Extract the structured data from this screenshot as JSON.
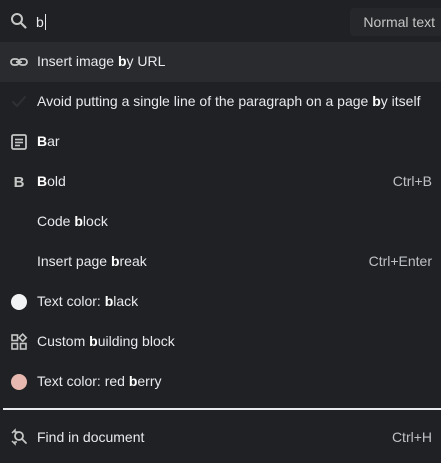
{
  "search": {
    "query": "b",
    "style_label": "Normal text"
  },
  "items": [
    {
      "icon": "link-icon",
      "pre": "Insert image ",
      "match": "b",
      "post": "y URL",
      "shortcut": ""
    },
    {
      "icon": "check-icon",
      "pre": "Avoid putting a single line of the paragraph on a page ",
      "match": "b",
      "post": "y itself",
      "shortcut": ""
    },
    {
      "icon": "paragraph-icon",
      "pre": "",
      "match": "B",
      "post": "ar",
      "shortcut": ""
    },
    {
      "icon": "bold-icon",
      "pre": "",
      "match": "B",
      "post": "old",
      "shortcut": "Ctrl+B"
    },
    {
      "icon": "",
      "pre": "Code ",
      "match": "b",
      "post": "lock",
      "shortcut": ""
    },
    {
      "icon": "",
      "pre": "Insert page ",
      "match": "b",
      "post": "reak",
      "shortcut": "Ctrl+Enter"
    },
    {
      "icon": "color-swatch-icon",
      "pre": "Text color: ",
      "match": "b",
      "post": "lack",
      "shortcut": ""
    },
    {
      "icon": "building-block-icon",
      "pre": "Custom ",
      "match": "b",
      "post": "uilding block",
      "shortcut": ""
    },
    {
      "icon": "color-swatch-icon",
      "pre": "Text color: red ",
      "match": "b",
      "post": "erry",
      "shortcut": ""
    }
  ],
  "swatches": {
    "black": "#f1f3f4",
    "red_berry": "#e6b8af"
  },
  "find": {
    "label": "Find in document",
    "shortcut": "Ctrl+H"
  }
}
